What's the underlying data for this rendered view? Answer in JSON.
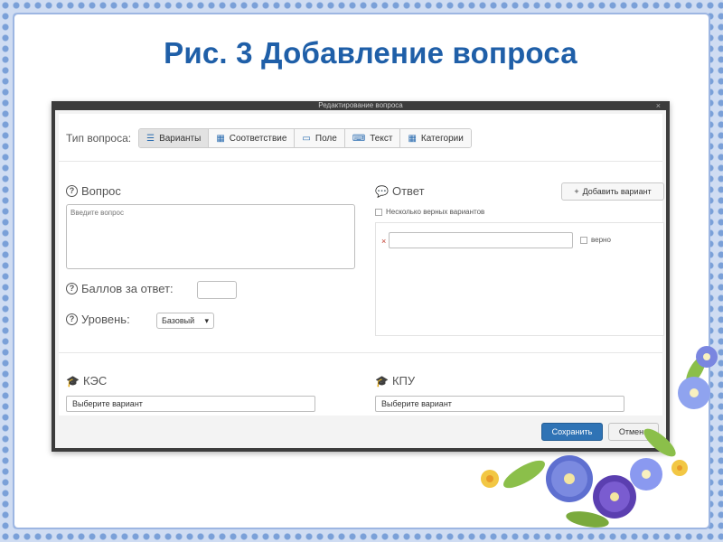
{
  "slide": {
    "title": "Рис. 3  Добавление вопроса"
  },
  "dialog": {
    "title": "Редактирование вопроса",
    "close": "×",
    "type_label": "Тип вопроса:",
    "types": [
      {
        "label": "Варианты",
        "icon": "list-icon",
        "glyph": "☰",
        "active": true
      },
      {
        "label": "Соответствие",
        "icon": "grid-icon",
        "glyph": "▦",
        "active": false
      },
      {
        "label": "Поле",
        "icon": "input-field-icon",
        "glyph": "▭",
        "active": false
      },
      {
        "label": "Текст",
        "icon": "keyboard-icon",
        "glyph": "⌨",
        "active": false
      },
      {
        "label": "Категории",
        "icon": "categories-icon",
        "glyph": "▦",
        "active": false
      }
    ],
    "question": {
      "label": "Вопрос",
      "placeholder": "Введите вопрос"
    },
    "points_label": "Баллов за ответ:",
    "level": {
      "label": "Уровень:",
      "value": "Базовый"
    },
    "answer": {
      "label": "Ответ",
      "add_button": "Добавить вариант",
      "multi_label": "Несколько верных вариантов",
      "correct_label": "верно",
      "remove_glyph": "×"
    },
    "kes": {
      "label": "КЭС",
      "value": "Выберите вариант"
    },
    "kpu": {
      "label": "КПУ",
      "value": "Выберите вариант"
    },
    "save_label": "Сохранить",
    "cancel_label": "Отмена"
  },
  "colors": {
    "title": "#1f5fa8",
    "primary_button": "#2f73b5",
    "frame": "#9db6e2"
  }
}
